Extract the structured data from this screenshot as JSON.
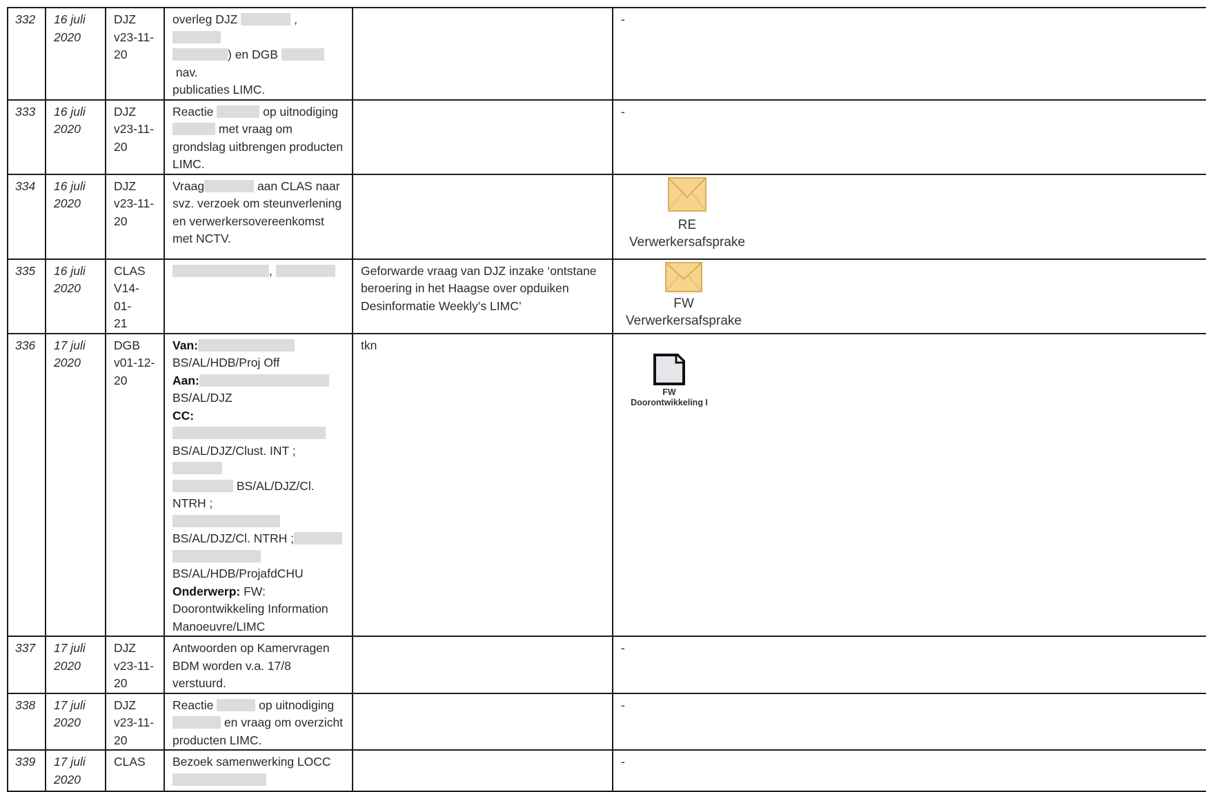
{
  "rows": [
    {
      "nr": "332",
      "date_line1": "16 juli",
      "date_line2": "2020",
      "src_line1": "DJZ",
      "src_line2": "v23-11-",
      "src_line3": "20",
      "desc": {
        "p1": "overleg DJZ",
        "p2": ",",
        "p3": ") en DGB",
        "p4": "nav.",
        "p5": "publicaties LIMC."
      },
      "remarks": "",
      "attachment": "-"
    },
    {
      "nr": "333",
      "date_line1": "16 juli",
      "date_line2": "2020",
      "src_line1": "DJZ",
      "src_line2": "v23-11-",
      "src_line3": "20",
      "desc": {
        "p1": "Reactie",
        "p2": "op uitnodiging",
        "p3": "met vraag om",
        "p4": "grondslag uitbrengen producten",
        "p5": "LIMC."
      },
      "remarks": "",
      "attachment": "-"
    },
    {
      "nr": "334",
      "date_line1": "16 juli",
      "date_line2": "2020",
      "src_line1": "DJZ",
      "src_line2": "v23-11-",
      "src_line3": "20",
      "desc": {
        "p1": "Vraag",
        "p2": "aan CLAS naar",
        "p3": "svz. verzoek om steunverlening",
        "p4": "en verwerkersovereenkomst",
        "p5": "met NCTV."
      },
      "remarks": "",
      "attachment": {
        "icon": "envelope-icon",
        "line1": "RE",
        "line2": "Verwerkersafsprake"
      }
    },
    {
      "nr": "335",
      "date_line1": "16 juli",
      "date_line2": "2020",
      "src_line1": "CLAS",
      "src_line2": "V14-01-",
      "src_line3": "21",
      "desc": {
        "p1": ","
      },
      "remarks": {
        "line1": "Geforwarde vraag van DJZ inzake  ‘ontstane",
        "line2": "beroering in het Haagse over opduiken",
        "line3": "Desinformatie Weekly’s LIMC’"
      },
      "attachment": {
        "icon": "envelope-icon",
        "line1": "FW",
        "line2": "Verwerkersafsprake"
      }
    },
    {
      "nr": "336",
      "date_line1": "17 juli",
      "date_line2": "2020",
      "src_line1": "DGB",
      "src_line2": "v01-12-",
      "src_line3": "20",
      "desc": {
        "van_label": "Van:",
        "van_value": "BS/AL/HDB/Proj Off",
        "aan_label": "Aan:",
        "aan_value": "BS/AL/DJZ",
        "cc_label": "CC:",
        "cc_value1": "BS/AL/DJZ/Clust. INT ;",
        "cc_value2": "BS/AL/DJZ/Cl. NTRH ;",
        "cc_value3": "BS/AL/DJZ/Cl. NTRH ;",
        "cc_value4": "BS/AL/HDB/ProjafdCHU",
        "onderwerp_label": "Onderwerp:",
        "onderwerp_value1": "FW:",
        "onderwerp_value2": "Doorontwikkeling Information",
        "onderwerp_value3": "Manoeuvre/LIMC"
      },
      "remarks": {
        "line1": "tkn"
      },
      "attachment": {
        "icon": "document-icon",
        "line1": "FW",
        "line2": "Doorontwikkeling I"
      }
    },
    {
      "nr": "337",
      "date_line1": "17 juli",
      "date_line2": "2020",
      "src_line1": "DJZ",
      "src_line2": "v23-11-",
      "src_line3": "20",
      "desc": {
        "p1": "Antwoorden op Kamervragen",
        "p2": "BDM worden v.a. 17/8",
        "p3": "verstuurd."
      },
      "remarks": "",
      "attachment": "-"
    },
    {
      "nr": "338",
      "date_line1": "17 juli",
      "date_line2": "2020",
      "src_line1": "DJZ",
      "src_line2": "v23-11-",
      "src_line3": "20",
      "desc": {
        "p1": "Reactie",
        "p2": "op uitnodiging",
        "p3": "en vraag om overzicht",
        "p4": "producten LIMC."
      },
      "remarks": "",
      "attachment": "-"
    },
    {
      "nr": "339",
      "date_line1": "17 juli",
      "date_line2": "2020",
      "src_line1": "CLAS",
      "desc": {
        "p1": "Bezoek samenwerking LOCC"
      },
      "remarks": "",
      "attachment": "-"
    }
  ]
}
